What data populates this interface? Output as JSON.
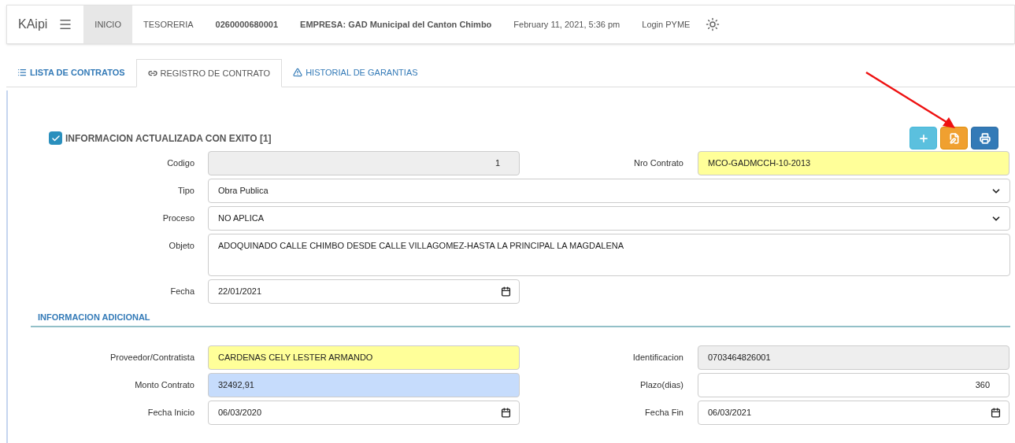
{
  "navbar": {
    "brand": "KAipi",
    "items": [
      {
        "label": "INICIO",
        "selected": true,
        "kind": "link"
      },
      {
        "label": "TESORERIA",
        "selected": false,
        "kind": "link"
      },
      {
        "label": "0260000680001",
        "selected": false,
        "kind": "bold"
      },
      {
        "label": "EMPRESA: GAD Municipal del Canton Chimbo",
        "selected": false,
        "kind": "bold"
      },
      {
        "label": "February 11, 2021, 5:36 pm",
        "selected": false,
        "kind": "text"
      },
      {
        "label": "Login PYME",
        "selected": false,
        "kind": "link"
      }
    ]
  },
  "tabs": [
    {
      "label": "LISTA DE CONTRATOS",
      "selected": false
    },
    {
      "label": "REGISTRO DE CONTRATO",
      "selected": true
    },
    {
      "label": "HISTORIAL DE GARANTIAS",
      "selected": false
    }
  ],
  "status": {
    "checked": true,
    "message": "INFORMACION ACTUALIZADA CON EXITO [1]"
  },
  "toolbar": [
    {
      "kind": "add"
    },
    {
      "kind": "save"
    },
    {
      "kind": "print"
    }
  ],
  "main_rows": [
    [
      {
        "label": "Codigo",
        "value": "1",
        "kind": "text"
      },
      {
        "label": "Nro Contrato",
        "value": "MCO-GADMCCH-10-2013",
        "kind": "text"
      }
    ],
    [
      {
        "label": "Tipo",
        "value": "Obra Publica",
        "kind": "select"
      }
    ],
    [
      {
        "label": "Proceso",
        "value": "NO APLICA",
        "kind": "select"
      }
    ],
    [
      {
        "label": "Objeto",
        "value": "ADOQUINADO CALLE  CHIMBO DESDE CALLE VILLAGOMEZ-HASTA LA PRINCIPAL LA MAGDALENA",
        "kind": "textarea"
      }
    ],
    [
      {
        "label": "Fecha",
        "value": "22/01/2021",
        "kind": "date"
      }
    ]
  ],
  "section_title": "INFORMACION ADICIONAL",
  "extra_rows": [
    [
      {
        "label": "Proveedor/Contratista",
        "value": "CARDENAS CELY LESTER ARMANDO",
        "kind": "text"
      },
      {
        "label": "Identificacion",
        "value": "0703464826001",
        "kind": "text"
      }
    ],
    [
      {
        "label": "Monto Contrato",
        "value": "32492,91",
        "kind": "text"
      },
      {
        "label": "Plazo(dias)",
        "value": "360",
        "kind": "text"
      }
    ],
    [
      {
        "label": "Fecha Inicio",
        "value": "06/03/2020",
        "kind": "date"
      },
      {
        "label": "Fecha Fin",
        "value": "06/03/2021",
        "kind": "date"
      }
    ]
  ]
}
